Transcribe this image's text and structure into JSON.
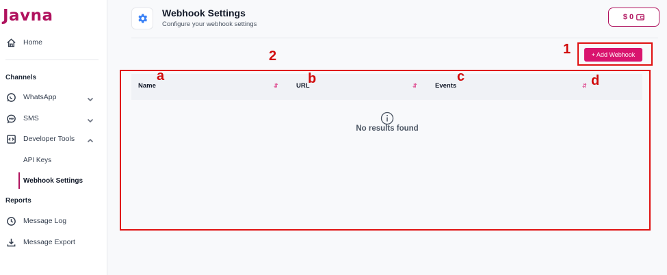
{
  "brand": {
    "logo_text": "Javna",
    "accent": "#b0125e",
    "button_color": "#d9146e"
  },
  "sidebar": {
    "home_label": "Home",
    "channels_heading": "Channels",
    "whatsapp_label": "WhatsApp",
    "sms_label": "SMS",
    "developer_tools_label": "Developer Tools",
    "api_keys_label": "API Keys",
    "webhook_settings_label": "Webhook Settings",
    "reports_heading": "Reports",
    "message_log_label": "Message Log",
    "message_export_label": "Message Export"
  },
  "header": {
    "title": "Webhook Settings",
    "subtitle": "Configure your webhook settings",
    "balance": "$ 0"
  },
  "actions": {
    "add_webhook_label": "+ Add Webhook"
  },
  "table": {
    "columns": [
      "Name",
      "URL",
      "Events"
    ],
    "empty_message": "No results found"
  },
  "annotations": {
    "n1": "1",
    "n2": "2",
    "a": "a",
    "b": "b",
    "c": "c",
    "d": "d"
  }
}
